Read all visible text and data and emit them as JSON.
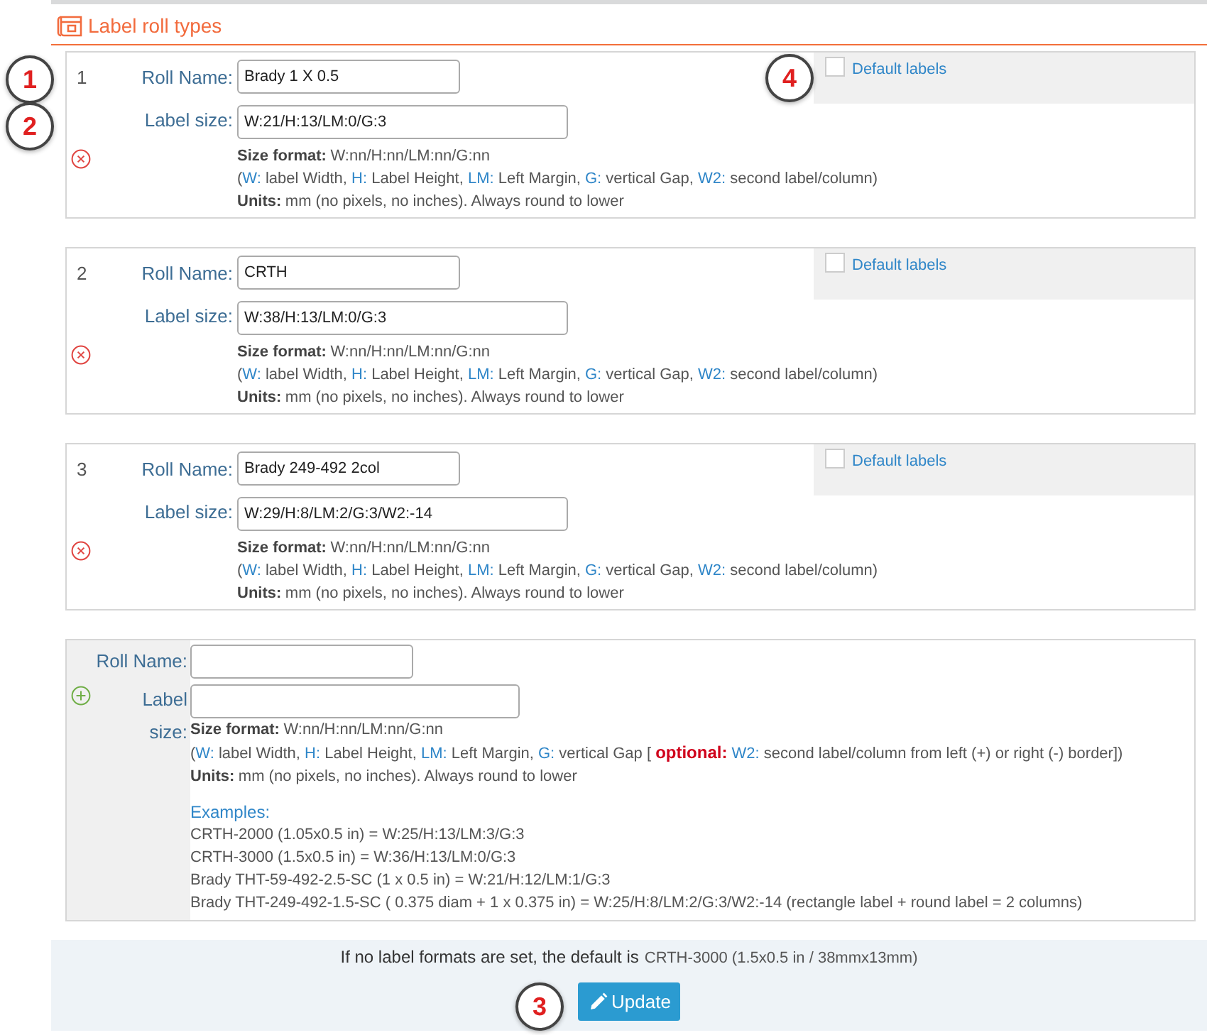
{
  "section": {
    "title": "Label roll types"
  },
  "rolls": [
    {
      "number": "1",
      "roll_name_label": "Roll Name:",
      "roll_name": "Brady 1 X 0.5",
      "label_size_label": "Label size:",
      "label_size": "W:21/H:13/LM:0/G:3",
      "default_label": "Default labels",
      "default_checked": false,
      "format_title": "Size format:",
      "format": "W:nn/H:nn/LM:nn/G:nn",
      "legend": [
        {
          "text": "(",
          "kind": "plain"
        },
        {
          "text": "W:",
          "kind": "key"
        },
        {
          "text": " label Width, ",
          "kind": "plain"
        },
        {
          "text": "H:",
          "kind": "key"
        },
        {
          "text": " Label Height, ",
          "kind": "plain"
        },
        {
          "text": "LM:",
          "kind": "key"
        },
        {
          "text": " Left Margin, ",
          "kind": "plain"
        },
        {
          "text": "G:",
          "kind": "key"
        },
        {
          "text": " vertical Gap, ",
          "kind": "plain"
        },
        {
          "text": "W2:",
          "kind": "key"
        },
        {
          "text": " second label/column)",
          "kind": "plain"
        }
      ],
      "units_title": "Units:",
      "units": "mm (no pixels, no inches). Always round to lower"
    },
    {
      "number": "2",
      "roll_name_label": "Roll Name:",
      "roll_name": "CRTH",
      "label_size_label": "Label size:",
      "label_size": "W:38/H:13/LM:0/G:3",
      "default_label": "Default labels",
      "default_checked": false,
      "format_title": "Size format:",
      "format": "W:nn/H:nn/LM:nn/G:nn",
      "legend": [
        {
          "text": "(",
          "kind": "plain"
        },
        {
          "text": "W:",
          "kind": "key"
        },
        {
          "text": " label Width, ",
          "kind": "plain"
        },
        {
          "text": "H:",
          "kind": "key"
        },
        {
          "text": " Label Height, ",
          "kind": "plain"
        },
        {
          "text": "LM:",
          "kind": "key"
        },
        {
          "text": " Left Margin, ",
          "kind": "plain"
        },
        {
          "text": "G:",
          "kind": "key"
        },
        {
          "text": " vertical Gap, ",
          "kind": "plain"
        },
        {
          "text": "W2:",
          "kind": "key"
        },
        {
          "text": " second label/column)",
          "kind": "plain"
        }
      ],
      "units_title": "Units:",
      "units": "mm (no pixels, no inches). Always round to lower"
    },
    {
      "number": "3",
      "roll_name_label": "Roll Name:",
      "roll_name": "Brady 249-492 2col",
      "label_size_label": "Label size:",
      "label_size": "W:29/H:8/LM:2/G:3/W2:-14",
      "default_label": "Default labels",
      "default_checked": false,
      "format_title": "Size format:",
      "format": "W:nn/H:nn/LM:nn/G:nn",
      "legend": [
        {
          "text": "(",
          "kind": "plain"
        },
        {
          "text": "W:",
          "kind": "key"
        },
        {
          "text": " label Width, ",
          "kind": "plain"
        },
        {
          "text": "H:",
          "kind": "key"
        },
        {
          "text": " Label Height, ",
          "kind": "plain"
        },
        {
          "text": "LM:",
          "kind": "key"
        },
        {
          "text": " Left Margin, ",
          "kind": "plain"
        },
        {
          "text": "G:",
          "kind": "key"
        },
        {
          "text": " vertical Gap, ",
          "kind": "plain"
        },
        {
          "text": "W2:",
          "kind": "key"
        },
        {
          "text": " second label/column)",
          "kind": "plain"
        }
      ],
      "units_title": "Units:",
      "units": "mm (no pixels, no inches). Always round to lower"
    }
  ],
  "new_roll": {
    "roll_name_label": "Roll Name:",
    "label_size_label": "Label size:",
    "format_title": "Size format:",
    "format": "W:nn/H:nn/LM:nn/G:nn",
    "legend": [
      {
        "text": "(",
        "kind": "plain"
      },
      {
        "text": "W:",
        "kind": "key"
      },
      {
        "text": " label Width, ",
        "kind": "plain"
      },
      {
        "text": "H:",
        "kind": "key"
      },
      {
        "text": " Label Height, ",
        "kind": "plain"
      },
      {
        "text": "LM:",
        "kind": "key"
      },
      {
        "text": " Left Margin, ",
        "kind": "plain"
      },
      {
        "text": "G:",
        "kind": "key"
      },
      {
        "text": " vertical Gap ",
        "kind": "plain"
      },
      {
        "text": "[ ",
        "kind": "plain"
      },
      {
        "text": "optional:",
        "kind": "optional"
      },
      {
        "text": " W2:",
        "kind": "key"
      },
      {
        "text": " second label/column from left (+) or right (-) border])",
        "kind": "plain"
      }
    ],
    "units_title": "Units:",
    "units": "mm (no pixels, no inches). Always round to lower",
    "examples_title": "Examples:",
    "examples": [
      "CRTH-2000 (1.05x0.5 in) = W:25/H:13/LM:3/G:3",
      "CRTH-3000 (1.5x0.5 in) = W:36/H:13/LM:0/G:3",
      "Brady THT-59-492-2.5-SC (1 x 0.5 in) = W:21/H:12/LM:1/G:3",
      "Brady THT-249-492-1.5-SC ( 0.375 diam + 1 x 0.375 in) = W:25/H:8/LM:2/G:3/W2:-14 (rectangle label + round label = 2 columns)"
    ]
  },
  "footer": {
    "note": "If no label formats are set, the default is",
    "note_default": "CRTH-3000 (1.5x0.5 in / 38mmx13mm)",
    "button": "Update"
  },
  "callouts": [
    {
      "number": "1"
    },
    {
      "number": "4"
    },
    {
      "number": "2"
    },
    {
      "number": "3"
    }
  ]
}
